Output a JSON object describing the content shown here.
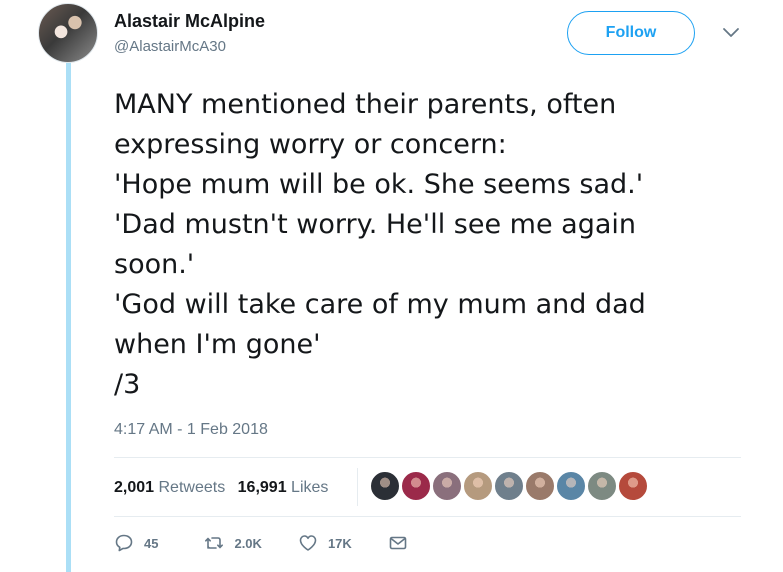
{
  "author": {
    "display_name": "Alastair McAlpine",
    "handle": "@AlastairMcA30"
  },
  "follow_label": "Follow",
  "tweet": {
    "lines": [
      "MANY mentioned their parents, often",
      "expressing worry or concern:",
      "'Hope mum will be ok. She seems sad.'",
      "'Dad mustn't worry. He'll see me again",
      "soon.'",
      "'God will take care of my mum and dad",
      "when I'm gone'",
      "/3"
    ],
    "timestamp": "4:17 AM - 1 Feb 2018"
  },
  "stats": {
    "retweets_count": "2,001",
    "retweets_label": "Retweets",
    "likes_count": "16,991",
    "likes_label": "Likes"
  },
  "likers": [
    {
      "name": "liker-avatar-1",
      "color": "#2b2f36"
    },
    {
      "name": "liker-avatar-2",
      "color": "#9b2a4a"
    },
    {
      "name": "liker-avatar-3",
      "color": "#8a6f7c"
    },
    {
      "name": "liker-avatar-4",
      "color": "#b59a7e"
    },
    {
      "name": "liker-avatar-5",
      "color": "#6f7f8c"
    },
    {
      "name": "liker-avatar-6",
      "color": "#9a7a6a"
    },
    {
      "name": "liker-avatar-7",
      "color": "#5a86a6"
    },
    {
      "name": "liker-avatar-8",
      "color": "#7d8a82"
    },
    {
      "name": "liker-avatar-9",
      "color": "#b54a3c"
    }
  ],
  "actions": {
    "reply_count": "45",
    "retweet_count": "2.0K",
    "like_count": "17K"
  },
  "icons": [
    "reply-icon",
    "retweet-icon",
    "heart-icon",
    "message-icon",
    "chevron-down-icon"
  ],
  "colors": {
    "accent": "#1da1f2",
    "muted": "#657786",
    "thread_line": "#abdff6"
  }
}
